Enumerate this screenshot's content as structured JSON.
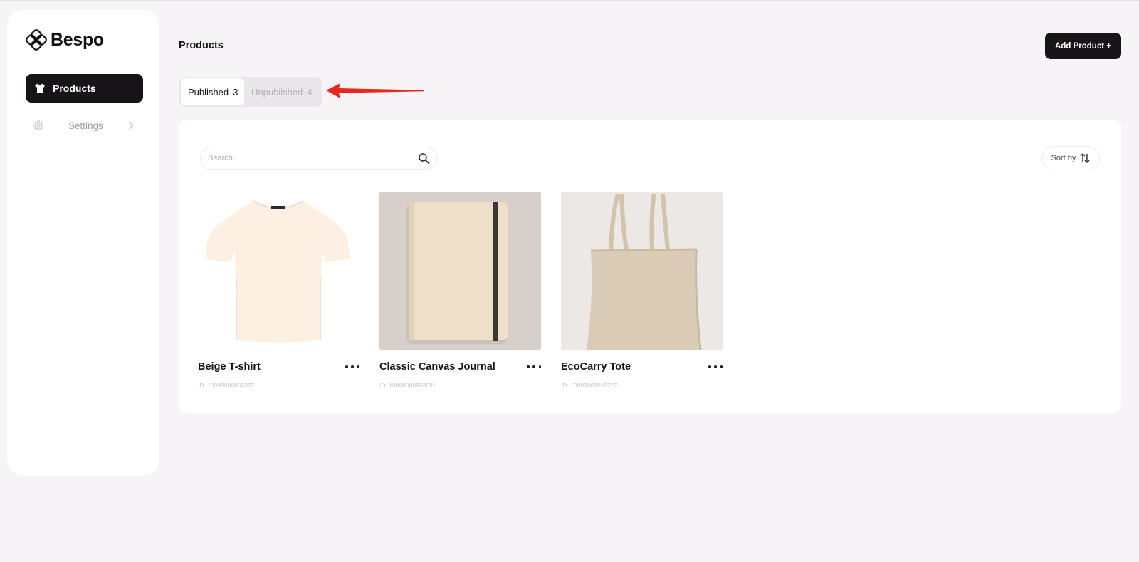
{
  "brand": {
    "name": "Bespo"
  },
  "sidebar": {
    "items": [
      {
        "label": "Products",
        "icon": "tshirt-icon",
        "active": true
      },
      {
        "label": "Settings",
        "icon": "gear-icon",
        "active": false
      }
    ]
  },
  "header": {
    "title": "Products",
    "add_button": "Add Product +"
  },
  "tabs": [
    {
      "label": "Published",
      "count": "3",
      "active": true
    },
    {
      "label": "Unpublished",
      "count": "4",
      "active": false
    }
  ],
  "toolbar": {
    "search_placeholder": "Search",
    "sort_label": "Sort by"
  },
  "products": [
    {
      "name": "Beige T-shirt",
      "id": "ID: 10098000855387",
      "image": "tshirt-image"
    },
    {
      "name": "Classic Canvas Journal",
      "id": "ID: 10098000953691",
      "image": "journal-image"
    },
    {
      "name": "EcoCarry Tote",
      "id": "ID: 10098001019227",
      "image": "tote-bag-image"
    }
  ],
  "colors": {
    "primary": "#161416",
    "background": "#f6f4f7",
    "annotation_arrow": "#e8281d"
  }
}
